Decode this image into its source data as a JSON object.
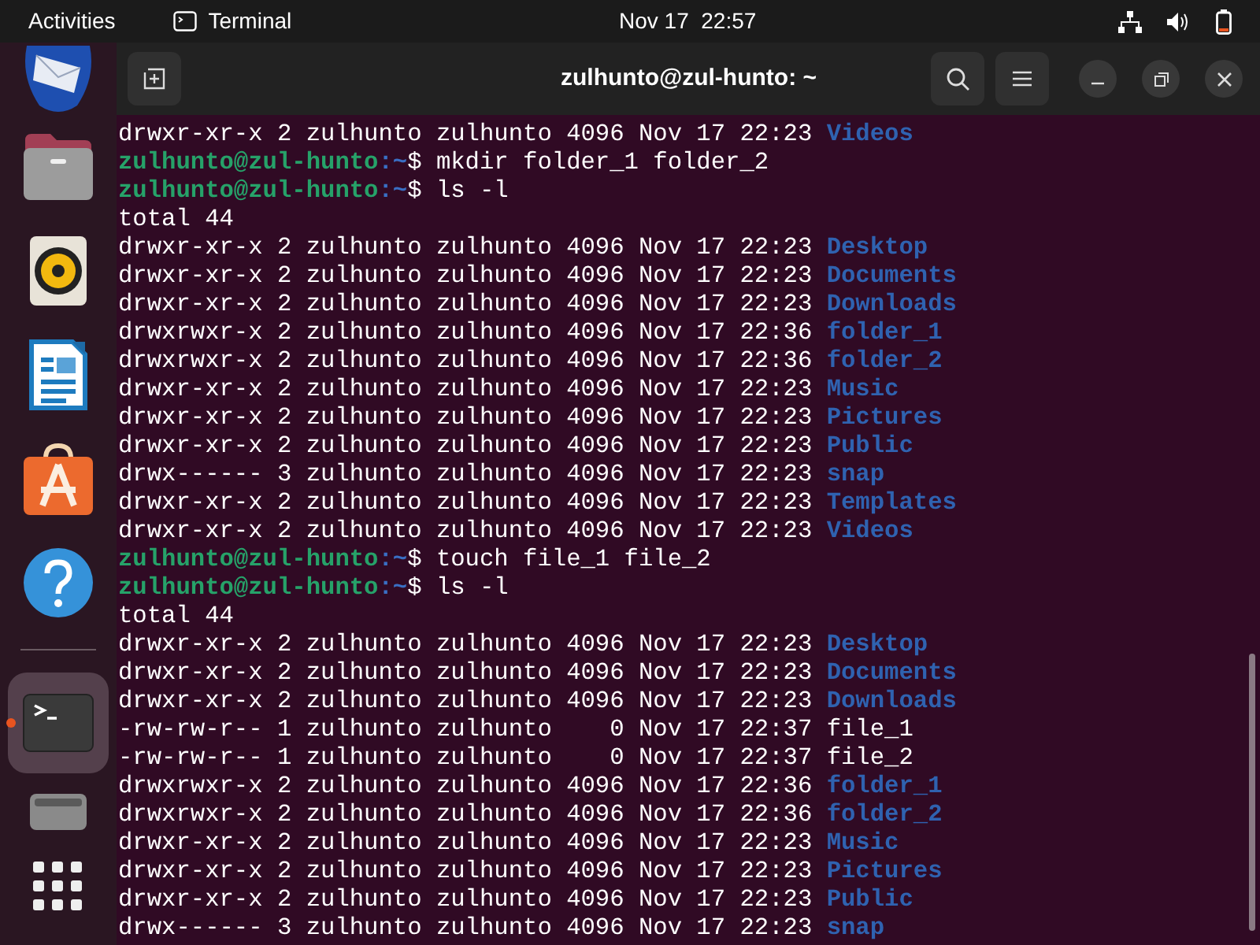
{
  "top_bar": {
    "activities": "Activities",
    "app_name": "Terminal",
    "clock": "Nov 17  22:57"
  },
  "dock": {
    "items": [
      {
        "kind": "mail",
        "active": false
      },
      {
        "kind": "files",
        "active": false
      },
      {
        "kind": "music",
        "active": false
      },
      {
        "kind": "writer",
        "active": false
      },
      {
        "kind": "software",
        "active": false
      },
      {
        "kind": "help",
        "active": false
      },
      {
        "kind": "separator"
      },
      {
        "kind": "terminal",
        "active": true
      },
      {
        "kind": "disk",
        "active": false
      },
      {
        "kind": "apps",
        "active": false
      }
    ]
  },
  "window": {
    "title": "zulhunto@zul-hunto: ~"
  },
  "terminal": {
    "lines": [
      {
        "kind": "entry",
        "is_dir": true,
        "info": "drwxr-xr-x 2 zulhunto zulhunto 4096 Nov 17 22:23",
        "name": "Videos"
      },
      {
        "kind": "prompt",
        "user": "zulhunto@zul-hunto",
        "path": ":~",
        "command": "$ mkdir folder_1 folder_2"
      },
      {
        "kind": "prompt",
        "user": "zulhunto@zul-hunto",
        "path": ":~",
        "command": "$ ls -l"
      },
      {
        "kind": "text",
        "text": "total 44"
      },
      {
        "kind": "entry",
        "is_dir": true,
        "info": "drwxr-xr-x 2 zulhunto zulhunto 4096 Nov 17 22:23",
        "name": "Desktop"
      },
      {
        "kind": "entry",
        "is_dir": true,
        "info": "drwxr-xr-x 2 zulhunto zulhunto 4096 Nov 17 22:23",
        "name": "Documents"
      },
      {
        "kind": "entry",
        "is_dir": true,
        "info": "drwxr-xr-x 2 zulhunto zulhunto 4096 Nov 17 22:23",
        "name": "Downloads"
      },
      {
        "kind": "entry",
        "is_dir": true,
        "info": "drwxrwxr-x 2 zulhunto zulhunto 4096 Nov 17 22:36",
        "name": "folder_1"
      },
      {
        "kind": "entry",
        "is_dir": true,
        "info": "drwxrwxr-x 2 zulhunto zulhunto 4096 Nov 17 22:36",
        "name": "folder_2"
      },
      {
        "kind": "entry",
        "is_dir": true,
        "info": "drwxr-xr-x 2 zulhunto zulhunto 4096 Nov 17 22:23",
        "name": "Music"
      },
      {
        "kind": "entry",
        "is_dir": true,
        "info": "drwxr-xr-x 2 zulhunto zulhunto 4096 Nov 17 22:23",
        "name": "Pictures"
      },
      {
        "kind": "entry",
        "is_dir": true,
        "info": "drwxr-xr-x 2 zulhunto zulhunto 4096 Nov 17 22:23",
        "name": "Public"
      },
      {
        "kind": "entry",
        "is_dir": true,
        "info": "drwx------ 3 zulhunto zulhunto 4096 Nov 17 22:23",
        "name": "snap"
      },
      {
        "kind": "entry",
        "is_dir": true,
        "info": "drwxr-xr-x 2 zulhunto zulhunto 4096 Nov 17 22:23",
        "name": "Templates"
      },
      {
        "kind": "entry",
        "is_dir": true,
        "info": "drwxr-xr-x 2 zulhunto zulhunto 4096 Nov 17 22:23",
        "name": "Videos"
      },
      {
        "kind": "prompt",
        "user": "zulhunto@zul-hunto",
        "path": ":~",
        "command": "$ touch file_1 file_2"
      },
      {
        "kind": "prompt",
        "user": "zulhunto@zul-hunto",
        "path": ":~",
        "command": "$ ls -l"
      },
      {
        "kind": "text",
        "text": "total 44"
      },
      {
        "kind": "entry",
        "is_dir": true,
        "info": "drwxr-xr-x 2 zulhunto zulhunto 4096 Nov 17 22:23",
        "name": "Desktop"
      },
      {
        "kind": "entry",
        "is_dir": true,
        "info": "drwxr-xr-x 2 zulhunto zulhunto 4096 Nov 17 22:23",
        "name": "Documents"
      },
      {
        "kind": "entry",
        "is_dir": true,
        "info": "drwxr-xr-x 2 zulhunto zulhunto 4096 Nov 17 22:23",
        "name": "Downloads"
      },
      {
        "kind": "entry",
        "is_dir": false,
        "info": "-rw-rw-r-- 1 zulhunto zulhunto    0 Nov 17 22:37",
        "name": "file_1"
      },
      {
        "kind": "entry",
        "is_dir": false,
        "info": "-rw-rw-r-- 1 zulhunto zulhunto    0 Nov 17 22:37",
        "name": "file_2"
      },
      {
        "kind": "entry",
        "is_dir": true,
        "info": "drwxrwxr-x 2 zulhunto zulhunto 4096 Nov 17 22:36",
        "name": "folder_1"
      },
      {
        "kind": "entry",
        "is_dir": true,
        "info": "drwxrwxr-x 2 zulhunto zulhunto 4096 Nov 17 22:36",
        "name": "folder_2"
      },
      {
        "kind": "entry",
        "is_dir": true,
        "info": "drwxr-xr-x 2 zulhunto zulhunto 4096 Nov 17 22:23",
        "name": "Music"
      },
      {
        "kind": "entry",
        "is_dir": true,
        "info": "drwxr-xr-x 2 zulhunto zulhunto 4096 Nov 17 22:23",
        "name": "Pictures"
      },
      {
        "kind": "entry",
        "is_dir": true,
        "info": "drwxr-xr-x 2 zulhunto zulhunto 4096 Nov 17 22:23",
        "name": "Public"
      },
      {
        "kind": "entry",
        "is_dir": true,
        "info": "drwx------ 3 zulhunto zulhunto 4096 Nov 17 22:23",
        "name": "snap"
      }
    ]
  }
}
